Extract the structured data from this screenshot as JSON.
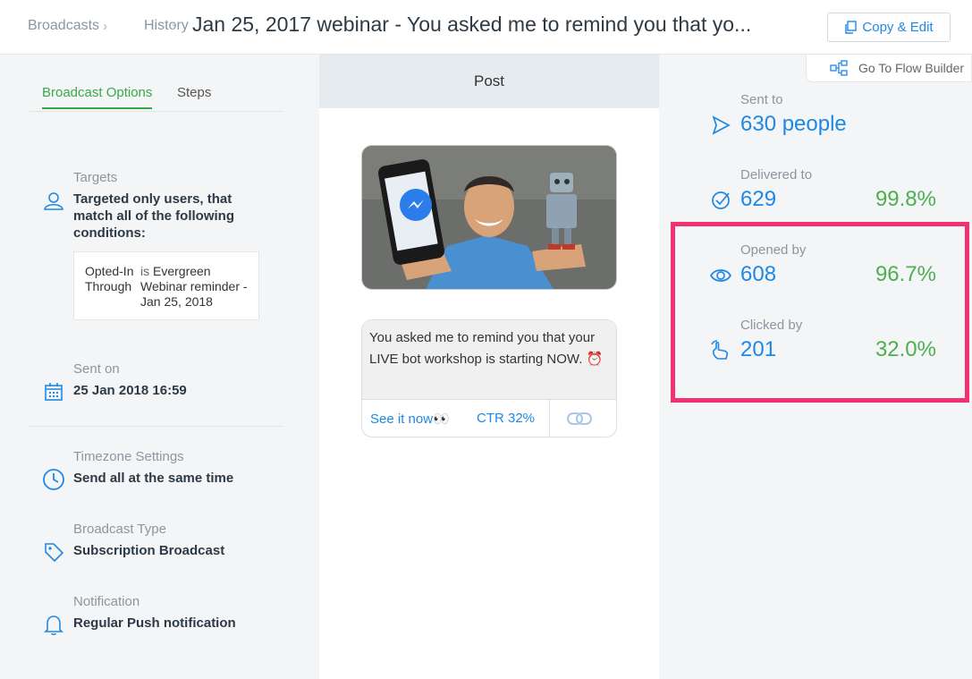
{
  "header": {
    "breadcrumb": [
      "Broadcasts",
      "History"
    ],
    "title": "Jan 25, 2017 webinar - You asked me to remind you that yo...",
    "copy_edit_label": "Copy & Edit",
    "flow_builder_label": "Go To Flow Builder"
  },
  "tabs": [
    {
      "label": "Broadcast Options",
      "active": true
    },
    {
      "label": "Steps",
      "active": false
    }
  ],
  "targets": {
    "label": "Targets",
    "value": "Targeted only users, that match all of the following conditions:",
    "condition": {
      "key": "Opted-In Through",
      "operator": "is",
      "value": "Evergreen Webinar reminder - Jan 25, 2018"
    }
  },
  "sent_on": {
    "label": "Sent on",
    "value": "25 Jan 2018 16:59"
  },
  "timezone": {
    "label": "Timezone Settings",
    "value": "Send all at the same time"
  },
  "broadcast_type": {
    "label": "Broadcast Type",
    "value": "Subscription Broadcast"
  },
  "notification": {
    "label": "Notification",
    "value": "Regular Push notification"
  },
  "post": {
    "header": "Post",
    "message": "You asked me to remind you that your LIVE bot workshop is starting NOW. ⏰",
    "button_label": "See it now👀",
    "ctr": "CTR 32%"
  },
  "stats": {
    "sent": {
      "label": "Sent to",
      "value": "630 people"
    },
    "delivered": {
      "label": "Delivered to",
      "value": "629",
      "pct": "99.8%"
    },
    "opened": {
      "label": "Opened by",
      "value": "608",
      "pct": "96.7%"
    },
    "clicked": {
      "label": "Clicked by",
      "value": "201",
      "pct": "32.0%"
    }
  },
  "colors": {
    "accent_blue": "#1e88e5",
    "accent_green": "#3aa74b",
    "stat_green": "#4caf50",
    "highlight": "#f23172"
  },
  "icons": [
    "copy-icon",
    "flow-builder-icon",
    "user-icon",
    "calendar-icon",
    "clock-icon",
    "tag-icon",
    "bell-icon",
    "send-icon",
    "check-circle-icon",
    "eye-icon",
    "tap-icon",
    "link-icon"
  ]
}
